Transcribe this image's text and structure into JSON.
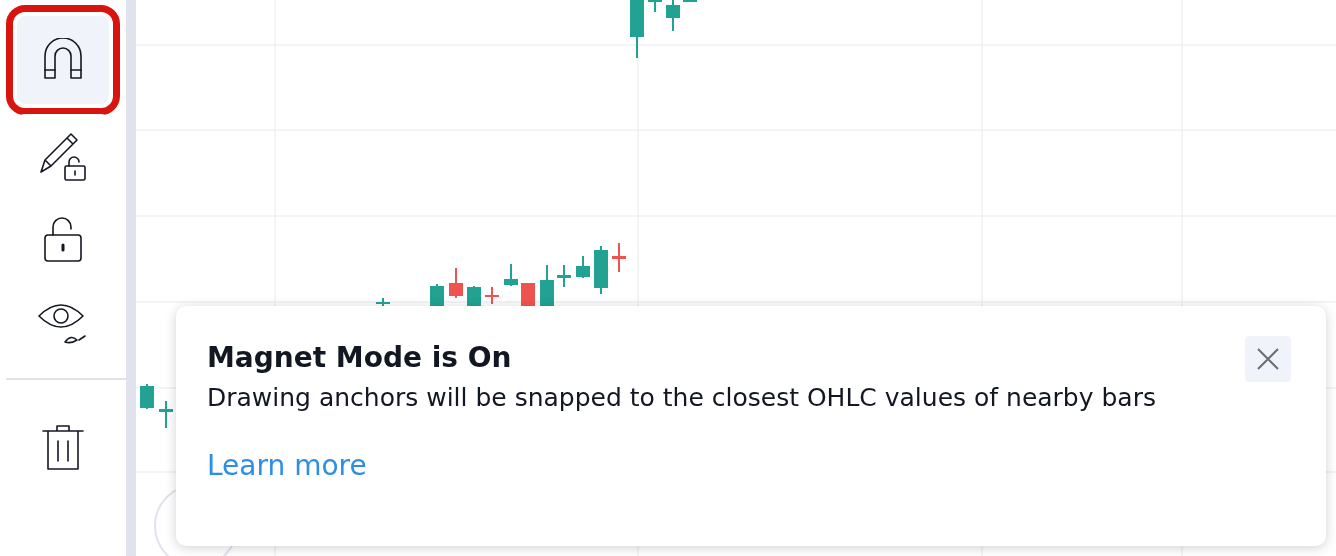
{
  "toolbar": {
    "tools": [
      {
        "kind": "magnet",
        "selected": true,
        "highlighted": true
      },
      {
        "kind": "pencil-lock",
        "selected": false,
        "highlighted": false
      },
      {
        "kind": "lock",
        "selected": false,
        "highlighted": false
      },
      {
        "kind": "eye",
        "selected": false,
        "highlighted": false
      },
      {
        "kind": "trash",
        "selected": false,
        "highlighted": false
      }
    ]
  },
  "popup": {
    "title": "Magnet Mode is On",
    "message": "Drawing anchors will be snapped to the closest OHLC values of nearby bars",
    "link": "Learn more"
  }
}
